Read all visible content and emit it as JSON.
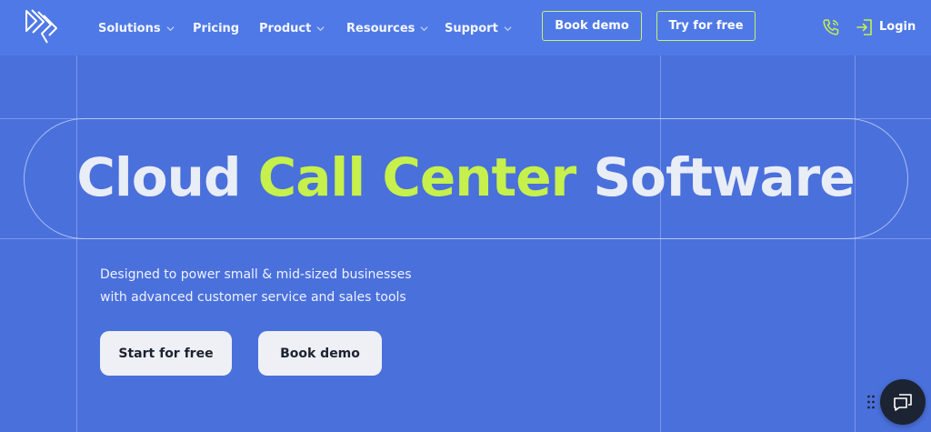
{
  "header": {
    "nav": [
      {
        "label": "Solutions",
        "has_dropdown": true
      },
      {
        "label": "Pricing",
        "has_dropdown": false
      },
      {
        "label": "Product",
        "has_dropdown": true
      },
      {
        "label": "Resources",
        "has_dropdown": true
      },
      {
        "label": "Support",
        "has_dropdown": true
      }
    ],
    "book_demo": "Book demo",
    "try_free": "Try for free",
    "login": "Login",
    "icons": {
      "logo": "brand-logo",
      "phone": "phone-icon",
      "login": "login-icon",
      "chevron": "chevron-down-icon"
    }
  },
  "hero": {
    "headline_start": "Cloud ",
    "headline_accent": "Call Center",
    "headline_end": " Software",
    "subtitle_line1": "Designed to power small & mid-sized businesses",
    "subtitle_line2": "with advanced customer service and sales tools",
    "cta_primary": "Start for free",
    "cta_secondary": "Book demo"
  },
  "chat_widget": {
    "icon": "chat-icon",
    "handle_icon": "drag-handle-icon"
  },
  "colors": {
    "header_bg": "#4f79e6",
    "hero_bg": "#4a70db",
    "accent": "#c6f04b",
    "button_light": "#eef0f5",
    "chat_bg": "#1c2433"
  }
}
